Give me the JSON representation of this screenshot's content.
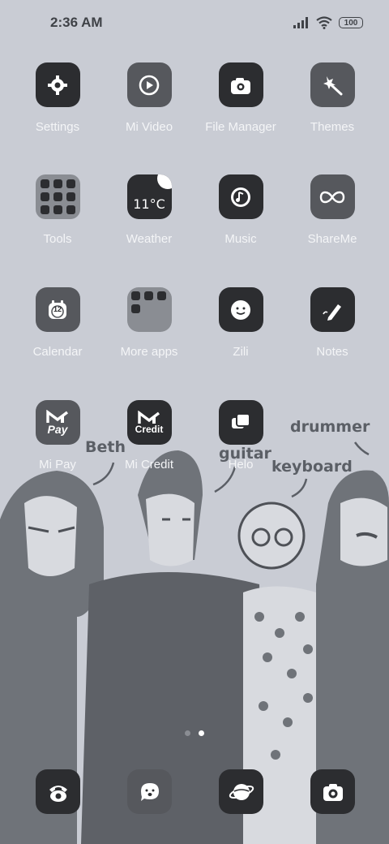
{
  "status_bar": {
    "time": "2:36 AM",
    "battery": "100"
  },
  "apps": [
    {
      "label": "Settings",
      "icon": "gear-icon"
    },
    {
      "label": "Mi Video",
      "icon": "play-icon"
    },
    {
      "label": "File Manager",
      "icon": "folder-camera-icon"
    },
    {
      "label": "Themes",
      "icon": "magic-wand-icon"
    },
    {
      "label": "Tools",
      "icon": "tools-folder-icon"
    },
    {
      "label": "Weather",
      "icon": "weather-icon",
      "temperature": "11°C"
    },
    {
      "label": "Music",
      "icon": "music-icon"
    },
    {
      "label": "ShareMe",
      "icon": "infinity-icon"
    },
    {
      "label": "Calendar",
      "icon": "calendar-icon",
      "day": "12"
    },
    {
      "label": "More apps",
      "icon": "more-apps-folder-icon"
    },
    {
      "label": "Zili",
      "icon": "zili-face-icon"
    },
    {
      "label": "Notes",
      "icon": "pencil-icon"
    },
    {
      "label": "Mi Pay",
      "icon": "mi-pay-icon",
      "badge": "Pay"
    },
    {
      "label": "Mi Credit",
      "icon": "mi-credit-icon",
      "badge": "Credit"
    },
    {
      "label": "Helo",
      "icon": "chat-bubbles-icon"
    }
  ],
  "dock": [
    {
      "name": "phone",
      "icon": "phone-icon"
    },
    {
      "name": "messages",
      "icon": "message-face-icon"
    },
    {
      "name": "browser",
      "icon": "planet-icon"
    },
    {
      "name": "camera",
      "icon": "camera-icon"
    }
  ],
  "wallpaper_text": [
    "Beth",
    "guitar",
    "keyboard",
    "drummer"
  ],
  "colors": {
    "background": "#c9ccd4",
    "icon_dark": "#2c2d30",
    "icon_mid": "#56585d",
    "wallpaper_ink": "#6f7379"
  }
}
